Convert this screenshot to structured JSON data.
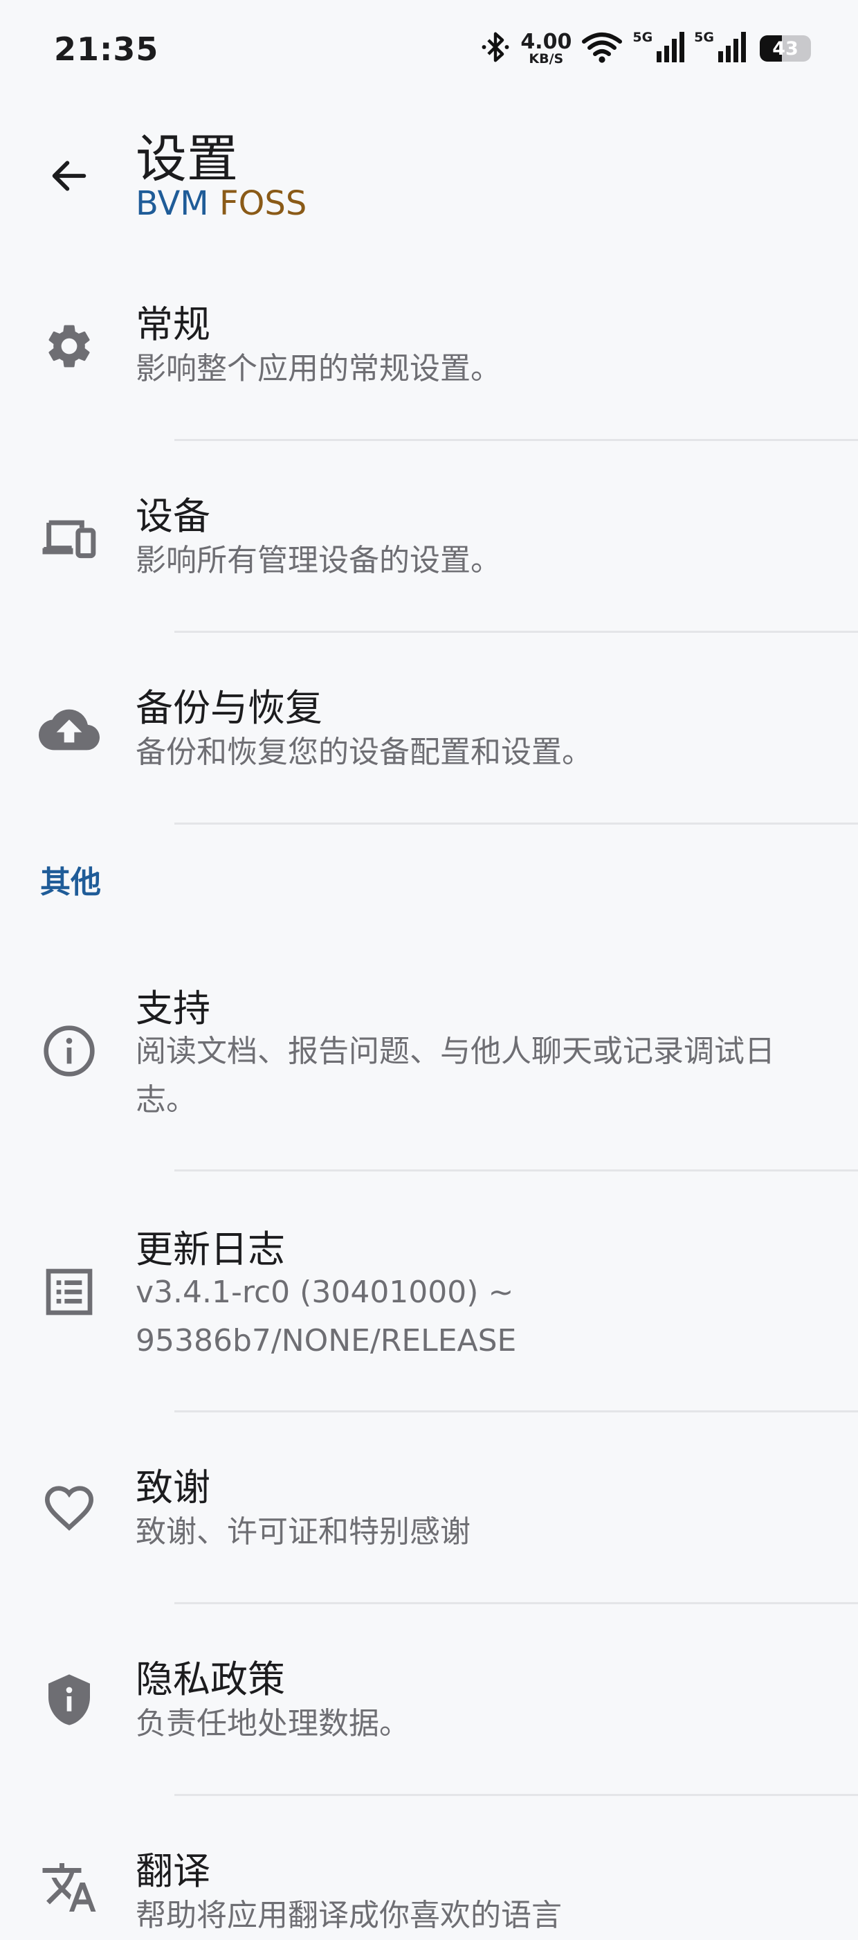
{
  "status_bar": {
    "time": "21:35",
    "net_speed": "4.00",
    "net_speed_unit": "KB/S",
    "sim1_label": "5G",
    "sim2_label": "5G",
    "battery": "43",
    "battery_level_percent": 43
  },
  "app_bar": {
    "title": "设置",
    "subtitle_part1": "BVM",
    "subtitle_part2": "FOSS",
    "back_icon": "arrow-back-icon"
  },
  "colors": {
    "accent": "#1f5c98",
    "foss": "#8a5a17",
    "icon": "#6e6e73",
    "background": "#f7f8fa"
  },
  "items": [
    {
      "title": "常规",
      "desc": "影响整个应用的常规设置。",
      "icon": "gear-icon"
    },
    {
      "title": "设备",
      "desc": "影响所有管理设备的设置。",
      "icon": "devices-icon"
    },
    {
      "title": "备份与恢复",
      "desc": "备份和恢复您的设备配置和设置。",
      "icon": "cloud-upload-icon"
    }
  ],
  "section_other": "其他",
  "other_items": [
    {
      "title": "支持",
      "desc": "阅读文档、报告问题、与他人聊天或记录调试日志。",
      "icon": "info-icon"
    },
    {
      "title": "更新日志",
      "desc": "v3.4.1-rc0 (30401000) ~ 95386b7/NONE/RELEASE",
      "icon": "list-icon"
    },
    {
      "title": "致谢",
      "desc": "致谢、许可证和特别感谢",
      "icon": "heart-icon"
    },
    {
      "title": "隐私政策",
      "desc": "负责任地处理数据。",
      "icon": "shield-icon"
    },
    {
      "title": "翻译",
      "desc": "帮助将应用翻译成你喜欢的语言",
      "icon": "translate-icon"
    }
  ]
}
